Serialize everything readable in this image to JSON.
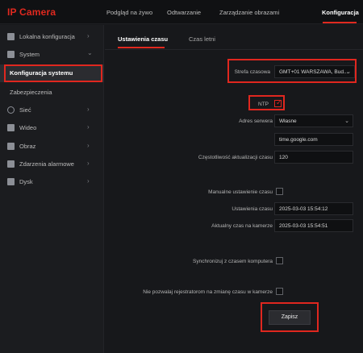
{
  "app": {
    "brand": "IP Camera"
  },
  "topnav": [
    "Podgląd na żywo",
    "Odtwarzanie",
    "Zarządzanie obrazami",
    "Konfiguracja"
  ],
  "sidebar": {
    "items": [
      {
        "label": "Lokalna konfiguracja",
        "icon": "monitor-icon"
      },
      {
        "label": "System",
        "icon": "system-icon"
      },
      {
        "label": "Konfiguracja systemu"
      },
      {
        "label": "Zabezpieczenia"
      },
      {
        "label": "Sieć",
        "icon": "network-icon"
      },
      {
        "label": "Wideo",
        "icon": "video-icon"
      },
      {
        "label": "Obraz",
        "icon": "image-icon"
      },
      {
        "label": "Zdarzenia alarmowe",
        "icon": "alarm-icon"
      },
      {
        "label": "Dysk",
        "icon": "disk-icon"
      }
    ]
  },
  "tabs": [
    "Ustawienia czasu",
    "Czas letni"
  ],
  "form": {
    "timezone_label": "Strefa czasowa",
    "timezone_value": "GMT+01 WARSZAWA, Bud...",
    "ntp_label": "NTP",
    "ntp_checked": true,
    "server_label": "Adres serwera",
    "server_value": "Własne",
    "server_address": "time.google.com",
    "interval_label": "Częstotliwość aktualizacji czasu",
    "interval_value": "120",
    "manual_label": "Manualne ustawienie czasu",
    "set_time_label": "Ustawienia czasu",
    "set_time_value": "2025-03-03 15:54:12",
    "camera_time_label": "Aktualny czas na kamerze",
    "camera_time_value": "2025-03-03 15:54:51",
    "sync_label": "Synchronizuj z czasem komputera",
    "no_change_label": "Nie pozwalaj rejestratorom na zmianę czasu w kamerze",
    "save_label": "Zapisz"
  },
  "colors": {
    "accent": "#e0291f",
    "background": "#17181b",
    "sidebar": "#1b1c1f"
  }
}
